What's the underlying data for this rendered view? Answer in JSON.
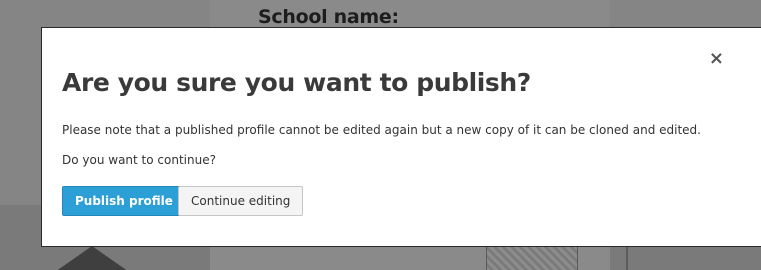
{
  "background": {
    "heading": "School name:"
  },
  "modal": {
    "title": "Are you sure you want to publish?",
    "note": "Please note that a published profile cannot be edited again but a new copy of it can be cloned and edited.",
    "question": "Do you want to continue?",
    "close_glyph": "×",
    "close_icon": "close-icon",
    "buttons": {
      "publish_label": "Publish profile",
      "continue_label": "Continue editing"
    }
  },
  "colors": {
    "primary": "#2b9fd6",
    "overlay": "#7d7d7d"
  }
}
